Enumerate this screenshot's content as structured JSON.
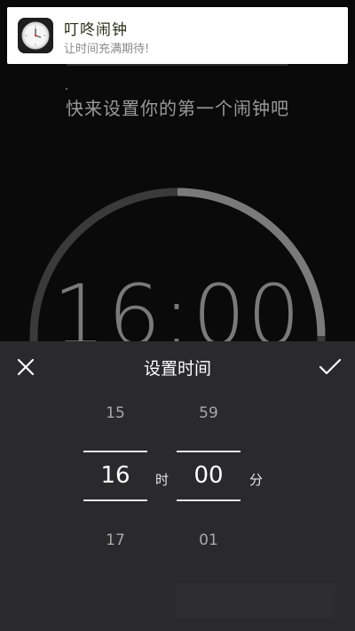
{
  "notification": {
    "app_title": "叮咚闹钟",
    "subtitle": "让时间充满期待!",
    "icon": "clock-icon"
  },
  "background": {
    "hint_text": "快来设置你的第一个闹钟吧",
    "time_display": "16:00",
    "ring_progress": 0.5
  },
  "sheet": {
    "title": "设置时间",
    "close_icon": "close-icon",
    "confirm_icon": "checkmark-icon",
    "hours": {
      "prev": "15",
      "selected": "16",
      "next": "17",
      "unit": "时"
    },
    "minutes": {
      "prev": "59",
      "selected": "00",
      "next": "01",
      "unit": "分"
    }
  },
  "colors": {
    "sheet_bg": "#2a2a2c",
    "ring_arc": "#7a7a7a",
    "ring_track": "#3a3a3a"
  }
}
